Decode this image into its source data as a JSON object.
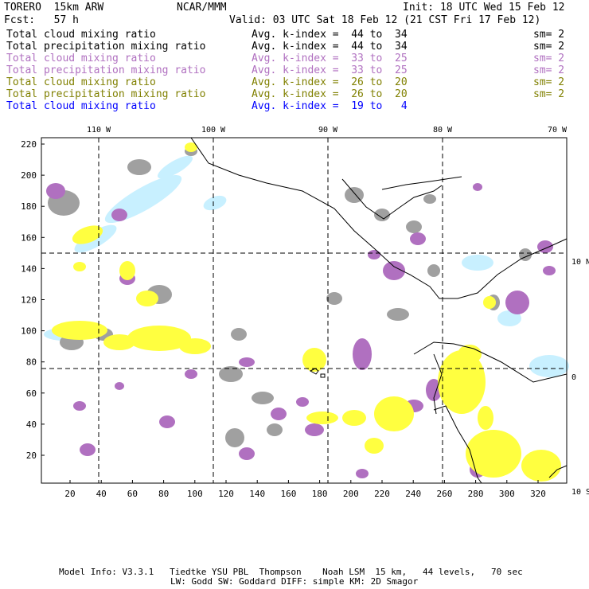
{
  "header": {
    "model": "TORERO  15km ARW",
    "org": "NCAR/MMM",
    "init": "Init: 18 UTC Wed 15 Feb 12",
    "fcst": "Fcst:   57 h",
    "valid": "Valid: 03 UTC Sat 18 Feb 12 (21 CST Fri 17 Feb 12)"
  },
  "legend": [
    {
      "field": "Total cloud mixing ratio",
      "range": "Avg. k-index =  44 to  34",
      "sm": "sm= 2",
      "color": "#000000"
    },
    {
      "field": "Total precipitation mixing ratio",
      "range": "Avg. k-index =  44 to  34",
      "sm": "sm= 2",
      "color": "#000000"
    },
    {
      "field": "Total cloud mixing ratio",
      "range": "Avg. k-index =  33 to  25",
      "sm": "sm= 2",
      "color": "#b070c0"
    },
    {
      "field": "Total precipitation mixing ratio",
      "range": "Avg. k-index =  33 to  25",
      "sm": "sm= 2",
      "color": "#b070c0"
    },
    {
      "field": "Total cloud mixing ratio",
      "range": "Avg. k-index =  26 to  20",
      "sm": "sm= 2",
      "color": "#808000"
    },
    {
      "field": "Total precipitation mixing ratio",
      "range": "Avg. k-index =  26 to  20",
      "sm": "sm= 2",
      "color": "#808000"
    },
    {
      "field": "Total cloud mixing ratio",
      "range": "Avg. k-index =  19 to   4",
      "sm": "",
      "color": "#0000ff"
    }
  ],
  "map": {
    "lon_labels": [
      "110 W",
      "100 W",
      "90 W",
      "80 W",
      "70 W"
    ],
    "lat_labels": [
      "10 N",
      "0",
      "10 S"
    ],
    "y_ticks": [
      "220",
      "200",
      "180",
      "160",
      "140",
      "120",
      "100",
      "80",
      "60",
      "40",
      "20"
    ],
    "x_ticks": [
      "20",
      "40",
      "60",
      "80",
      "100",
      "120",
      "140",
      "160",
      "180",
      "200",
      "220",
      "240",
      "260",
      "280",
      "300",
      "320"
    ],
    "field_colors": {
      "gray": "#a0a0a0",
      "purple": "#b070c0",
      "yellow": "#ffff40",
      "lightblue": "#c8f0ff"
    }
  },
  "footer": {
    "line1": "Model Info: V3.3.1   Tiedtke YSU PBL  Thompson    Noah LSM  15 km,   44 levels,   70 sec",
    "line2": "LW: Godd SW: Goddard DIFF: simple KM: 2D Smagor"
  }
}
